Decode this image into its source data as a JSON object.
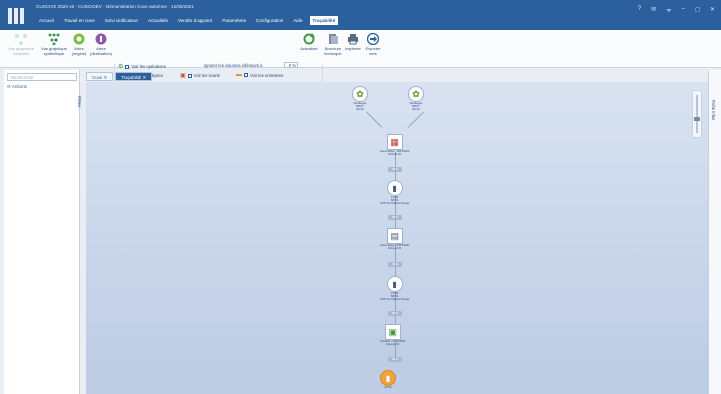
{
  "window": {
    "title": "CUSCIVE 2020 v9 · CUSCIDEV · Démonstration Cuve automne · 12/05/2021"
  },
  "menu": {
    "items": [
      "Accueil",
      "Travail en cuve",
      "Suivi vinificateur",
      "Actualités",
      "Vendre d'appoint",
      "Paramètres",
      "Configuration",
      "Aide",
      "Traçabilité"
    ],
    "active": "Traçabilité"
  },
  "ribbon": {
    "btn_full": "Vue graphique complète",
    "btn_synth": "Vue graphique synthétique",
    "btn_origin": "Arbre (origine)",
    "btn_dest": "Arbre (destination)",
    "group_display": "Affichage",
    "chk_operations": "Voir les opérations",
    "chk_analyses": "Voir les analyses",
    "chk_ecarts": "Voir les écarts",
    "chk_entretiens": "Voir les entretiens",
    "ignore_label": "Ignorer les volumes inférieurs à",
    "ignore_value": "0 %",
    "btn_refresh": "Actualiser",
    "group_info": "Informations",
    "btn_brochure": "Brochure technique",
    "btn_print": "Imprimer",
    "btn_export": "Exporter vers",
    "group_print": "Impression"
  },
  "left": {
    "search_placeholder": "Rechercher",
    "actions_label": "Actions",
    "filters_label": "Filtres"
  },
  "tabs": [
    "Cuve",
    "Traçabilité"
  ],
  "right_panel_label": "Fiche infos",
  "graph": {
    "nodes": [
      {
        "kind": "grape",
        "label1": "Vendanges",
        "label2": "BRUT",
        "label3": "Recolt"
      },
      {
        "kind": "grape",
        "label1": "Vendanges",
        "label2": "BRUT",
        "label3": "Recolt"
      },
      {
        "kind": "square",
        "label1": "Assemblage - 15/11/2020",
        "label2": "Mouvoir 60"
      },
      {
        "kind": "circle",
        "label1": "CUVE",
        "label2": "BR 5b",
        "label3": "AOP Vin Collioure Rouge"
      },
      {
        "kind": "square",
        "label1": "Assemblage - 05/01/2021",
        "label2": "Mouvoir 60"
      },
      {
        "kind": "circle",
        "label1": "CUVE",
        "label2": "BR 5b",
        "label3": "AOP Vin Collioure Rouge"
      },
      {
        "kind": "square",
        "label1": "Transfert - 07/01/2021",
        "label2": "Mouvoir 60"
      },
      {
        "kind": "circle",
        "label1": "CUVE",
        "label2": "",
        "label3": ""
      }
    ],
    "pill_labels": [
      "80 hl",
      "80 hl",
      "80 hl",
      "80 hl",
      "80 hl",
      "80 hl"
    ]
  },
  "colors": {
    "brand": "#2c5f9e",
    "canvas": "#c9d6ea",
    "highlight": "#f0a23c"
  }
}
